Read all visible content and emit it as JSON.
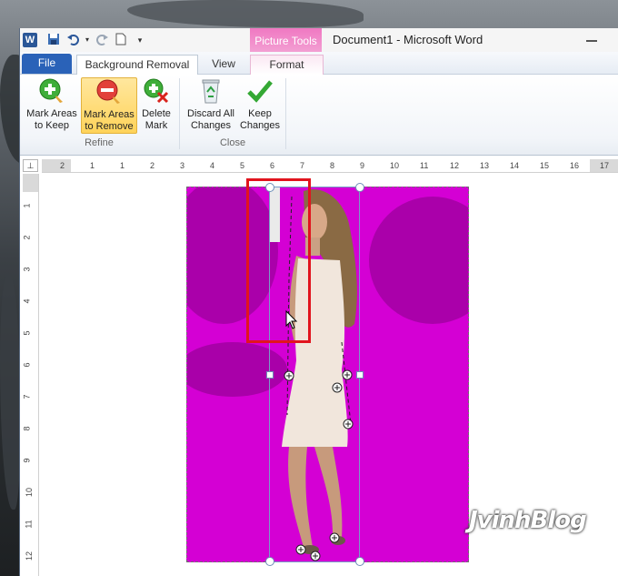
{
  "window": {
    "title": "Document1  -  Microsoft Word",
    "app_icon": "W",
    "quick_access": [
      "save-icon",
      "undo-icon",
      "redo-icon",
      "new-document-icon",
      "customize-dropdown-icon"
    ]
  },
  "contextual_tab_group": "Picture Tools",
  "tabs": {
    "file": "File",
    "background_removal": "Background Removal",
    "view": "View",
    "format": "Format"
  },
  "ribbon": {
    "refine": {
      "label": "Refine",
      "mark_keep": {
        "line1": "Mark Areas",
        "line2": "to Keep",
        "icon": "green-plus-pencil-icon"
      },
      "mark_remove": {
        "line1": "Mark Areas",
        "line2": "to Remove",
        "icon": "red-minus-pencil-icon",
        "active": true
      },
      "delete_mark": {
        "line1": "Delete",
        "line2": "Mark",
        "icon": "delete-mark-icon"
      }
    },
    "close": {
      "label": "Close",
      "discard": {
        "line1": "Discard All",
        "line2": "Changes",
        "icon": "recycle-bin-icon"
      },
      "keep": {
        "line1": "Keep",
        "line2": "Changes",
        "icon": "green-checkmark-icon"
      }
    }
  },
  "ruler": {
    "corner_symbol": "⊥",
    "h_numbers": [
      "2",
      "1",
      "1",
      "2",
      "3",
      "4",
      "5",
      "6",
      "7",
      "8",
      "9",
      "10",
      "11",
      "12",
      "13",
      "14",
      "15",
      "16",
      "17"
    ],
    "v_numbers": [
      "1",
      "2",
      "3",
      "4",
      "5",
      "6",
      "7",
      "8",
      "9",
      "10",
      "11",
      "12"
    ]
  },
  "colors": {
    "remove_overlay": "#d400d4",
    "file_tab": "#2a62b8",
    "contextual": "#f078c2",
    "highlight_box": "#e1141e"
  },
  "watermark": "JvinhBlog"
}
